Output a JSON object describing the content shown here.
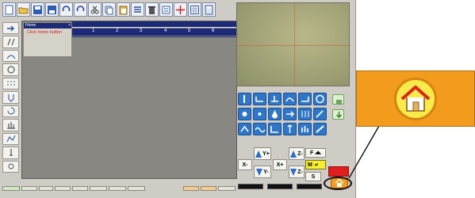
{
  "popup": {
    "title": "Home",
    "close": "×",
    "message": "Click home button"
  },
  "grid": {
    "columns": [
      "1",
      "2",
      "3",
      "4",
      "5",
      "6"
    ]
  },
  "jog": {
    "x_minus": "X-",
    "x_plus": "X+",
    "y_plus": "Y+",
    "y_minus": "Y-",
    "z_plus": "Z-",
    "z_minus": "Z-",
    "f_label": "F",
    "m_label": "M",
    "s_label": "S"
  },
  "toolbar": {
    "icons": [
      "new-icon",
      "open-icon",
      "save-icon",
      "save-as-icon",
      "undo-icon",
      "redo-icon",
      "cut-icon",
      "copy-icon",
      "paste-icon",
      "list-icon",
      "delete-icon",
      "properties-icon",
      "crosshair-icon",
      "grid-icon",
      "calculator-icon"
    ]
  },
  "colors": {
    "accent_orange": "#f29b1d",
    "home_yellow": "#f7ea4a",
    "grid_blue": "#1c2a78",
    "tool_blue": "#2e76c7",
    "warning_red": "#e11d1d"
  }
}
